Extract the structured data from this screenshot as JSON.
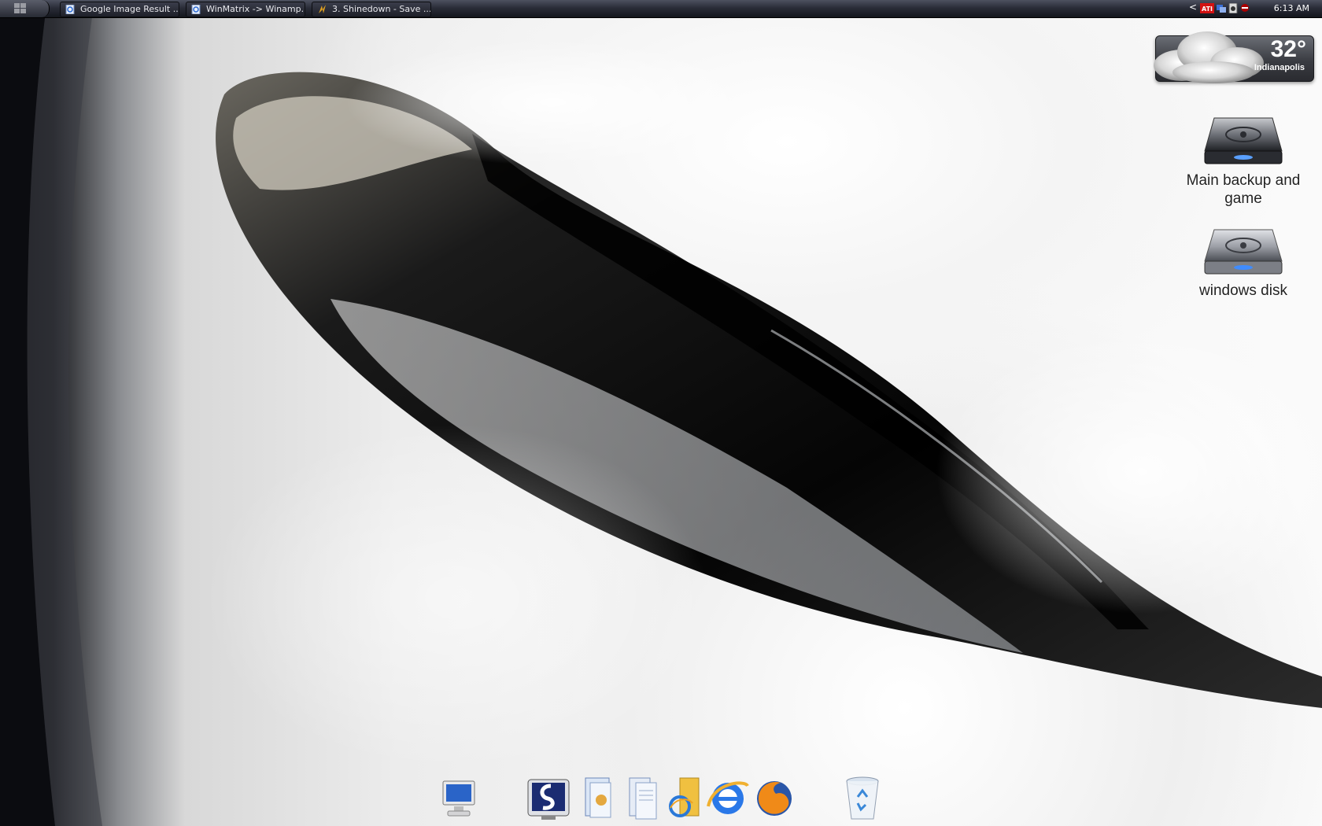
{
  "taskbar": {
    "tasks": [
      {
        "label": "Google Image Result ...",
        "icon": "ie-page-icon"
      },
      {
        "label": "WinMatrix -> Winamp...",
        "icon": "ie-page-icon"
      },
      {
        "label": "3. Shinedown - Save ...",
        "icon": "winamp-icon"
      }
    ],
    "tray": {
      "clock": "6:13 AM",
      "chevron": "<"
    }
  },
  "weather": {
    "temperature": "32°",
    "city": "Indianapolis"
  },
  "desktop_icons": [
    {
      "label": "Main backup and game",
      "icon": "hard-drive-icon"
    },
    {
      "label": "windows disk",
      "icon": "hard-drive-icon"
    }
  ],
  "dock": {
    "items": [
      "my-computer-icon",
      "stardock-icon",
      "documents-icon",
      "files-icon",
      "folder-ie-icon",
      "internet-explorer-icon",
      "firefox-icon",
      "recycle-bin-icon"
    ]
  },
  "colors": {
    "taskbar": "#1e2029",
    "text_light": "#e9e9ee",
    "desktop_label": "#222222"
  }
}
